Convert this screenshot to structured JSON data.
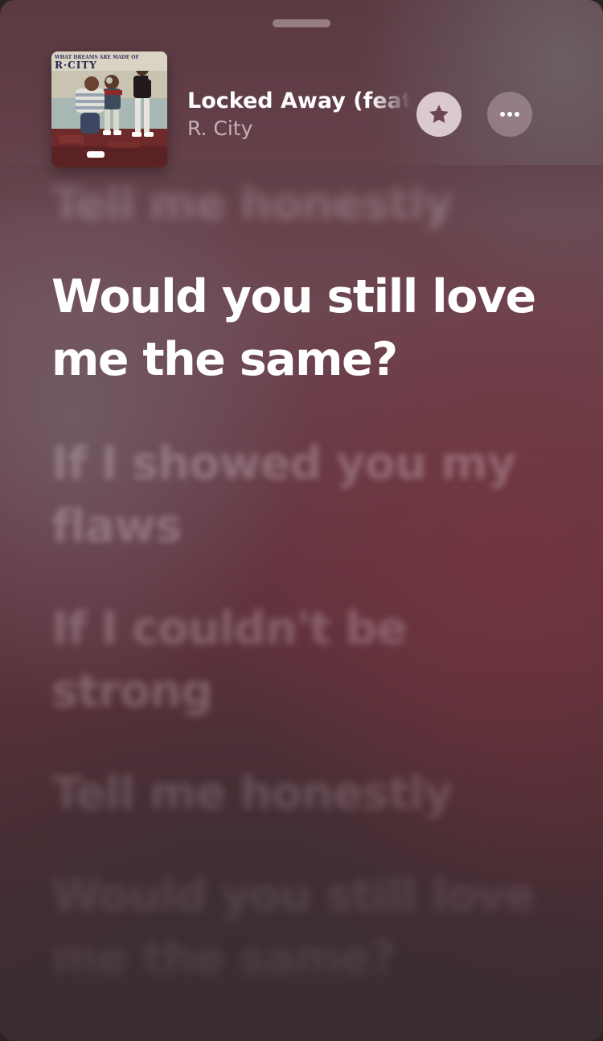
{
  "now_playing": {
    "title": "Locked Away (feat. Adam Levine)",
    "artist": "R. City",
    "artwork": {
      "album_text_small": "WHAT DREAMS ARE MADE OF",
      "album_text_large": "R·CITY"
    }
  },
  "buttons": {
    "favorite_icon": "star-icon",
    "more_icon": "ellipsis-icon"
  },
  "lyrics": {
    "previous": "Tell me honestly",
    "current": "Would you still love me the same?",
    "upcoming": [
      "If I showed you my flaws",
      "If I couldn't be strong",
      "Tell me honestly",
      "Would you still love me the same?"
    ]
  },
  "colors": {
    "background_top": "#5b3a42",
    "background_mid": "#63343f",
    "background_bottom": "#3a2c30",
    "active_lyric": "#ffffff"
  }
}
